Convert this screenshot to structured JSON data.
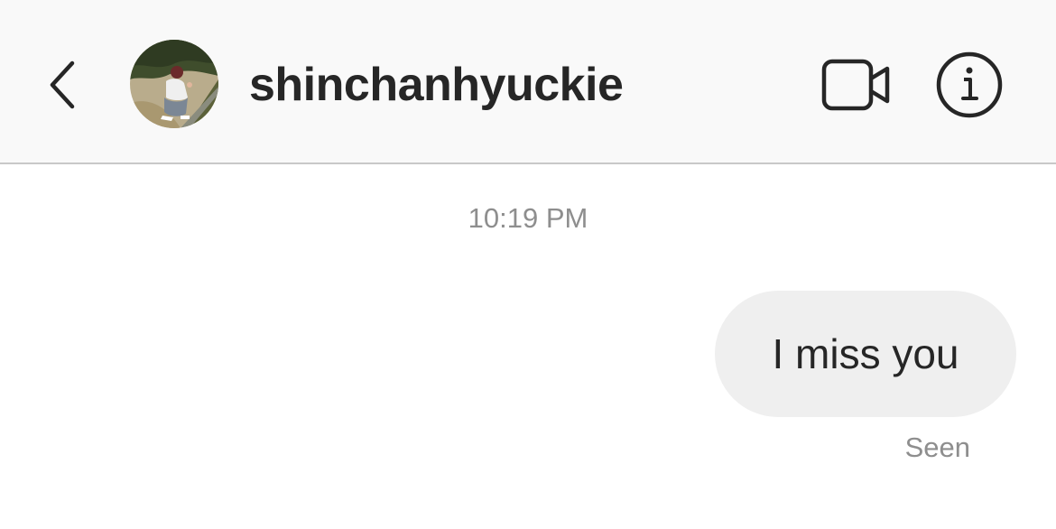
{
  "header": {
    "username": "shinchanhyuckie",
    "back_icon": "chevron-left-icon",
    "video_icon": "video-camera-icon",
    "info_icon": "info-icon"
  },
  "conversation": {
    "timestamp": "10:19 PM",
    "messages": [
      {
        "text": "I miss you",
        "sender": "self",
        "status": "Seen"
      }
    ]
  },
  "colors": {
    "header_bg": "#f9f9f9",
    "bubble_bg": "#efefef",
    "text_primary": "#262626",
    "text_secondary": "#8e8e8e"
  }
}
